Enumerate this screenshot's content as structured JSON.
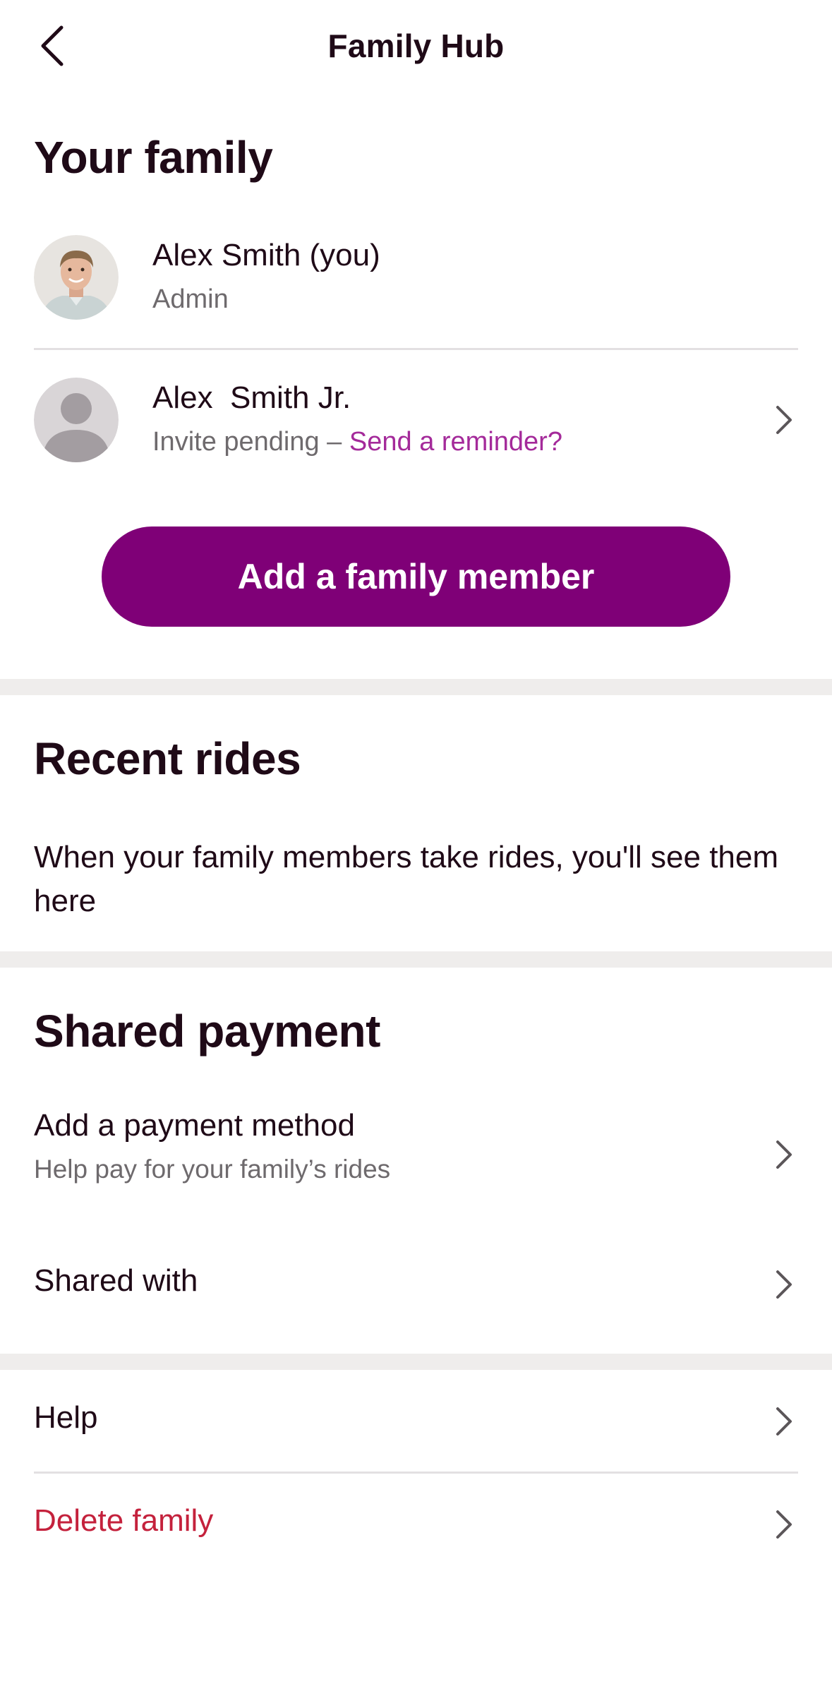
{
  "header": {
    "title": "Family Hub",
    "back_icon": "chevron-left-icon"
  },
  "family": {
    "title": "Your family",
    "members": [
      {
        "name": "Alex Smith (you)",
        "role": "Admin",
        "avatar": "user-photo"
      },
      {
        "name": "Alex  Smith Jr.",
        "status": "Invite pending – ",
        "reminder_link": "Send a reminder?",
        "avatar": "default-person-icon"
      }
    ],
    "add_button": "Add a family member"
  },
  "rides": {
    "title": "Recent rides",
    "empty_text": "When your family members take rides, you'll see them here"
  },
  "payment": {
    "title": "Shared payment",
    "add_method": {
      "title": "Add a payment method",
      "subtitle": "Help pay for your family’s rides"
    },
    "shared_with": "Shared with"
  },
  "footer": {
    "help": "Help",
    "delete": "Delete family"
  },
  "colors": {
    "accent": "#7f0077",
    "link": "#a42a9a",
    "danger": "#c4213c",
    "text": "#1f0a17",
    "muted": "#6e6a6d",
    "band": "#efedec"
  }
}
